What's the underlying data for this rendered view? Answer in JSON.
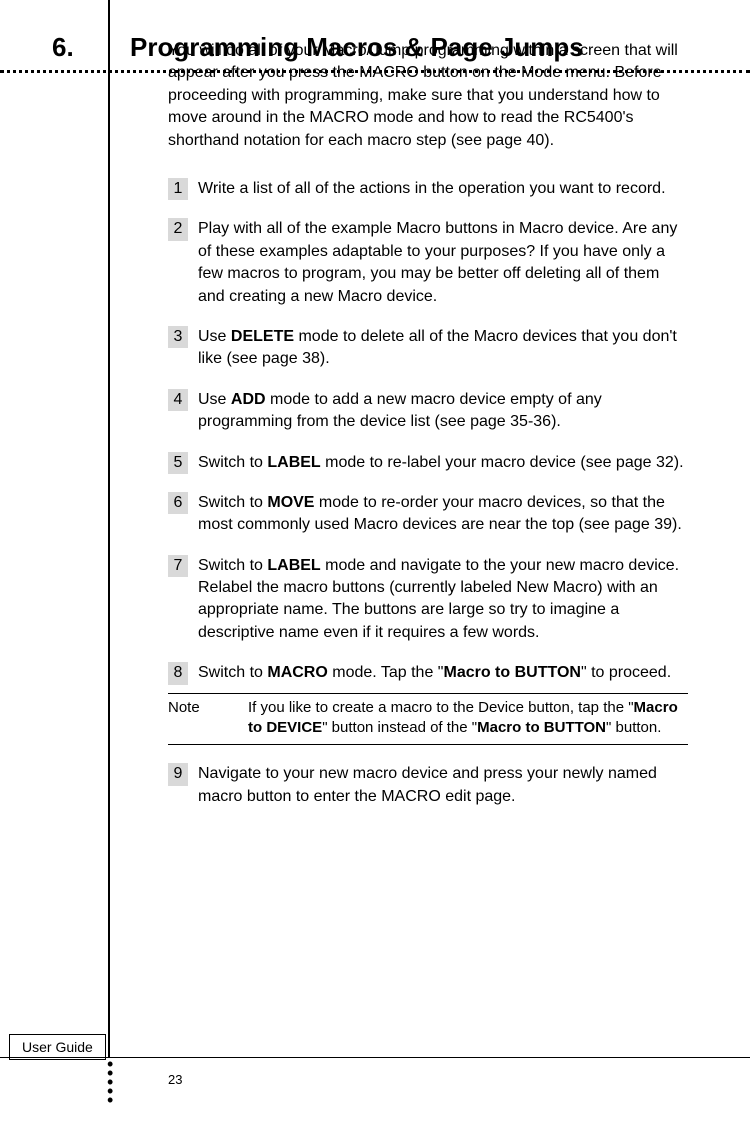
{
  "chapter": {
    "number": "6.",
    "title": "Programming Macros & Page Jumps"
  },
  "intro": "You will do all of your Macro/Jump programming within a screen that will appear after you press the MACRO button on the Mode menu. Before proceeding with programming, make sure that you understand how to move around in the MACRO mode and how to read the RC5400's shorthand notation for each macro step (see page 40).",
  "steps": {
    "s1": {
      "n": "1",
      "t": "Write a list of all of the actions in the operation you want to record."
    },
    "s2": {
      "n": "2",
      "t": "Play with all of the example Macro buttons in Macro device. Are any of these examples adaptable to your purposes?  If you have only a few macros to program, you may be better off deleting all of them and creating a new Macro device."
    },
    "s3": {
      "n": "3",
      "t_pre": "Use ",
      "t_b": "DELETE",
      "t_post": " mode to delete all of the Macro devices that you don't like (see page 38)."
    },
    "s4": {
      "n": "4",
      "t_pre": "Use ",
      "t_b": "ADD",
      "t_post": " mode to add a new macro device empty of any programming from the device list (see page 35-36)."
    },
    "s5": {
      "n": "5",
      "t_pre": "Switch to ",
      "t_b": "LABEL",
      "t_post": " mode to re-label your macro device (see page 32)."
    },
    "s6": {
      "n": "6",
      "t_pre": "Switch to ",
      "t_b": "MOVE",
      "t_post": " mode to re-order your macro devices, so that the most commonly used Macro devices are near the top (see page 39)."
    },
    "s7": {
      "n": "7",
      "t_pre": "Switch to ",
      "t_b": "LABEL",
      "t_post": " mode and navigate to the your new macro device. Relabel the macro buttons (currently labeled New Macro) with an appropriate name. The buttons are large so try to imagine a descriptive name even if it requires a few words."
    },
    "s8": {
      "n": "8",
      "t_pre": "Switch to ",
      "t_b1": "MACRO",
      "t_mid": " mode. Tap the \"",
      "t_b2": "Macro to BUTTON",
      "t_post": "\" to proceed."
    },
    "s9": {
      "n": "9",
      "t": "Navigate to your new macro device and press your newly named macro button to enter the MACRO edit page."
    }
  },
  "note": {
    "label": "Note",
    "pre": "If you like to create a macro to the Device button, tap the \"",
    "b1": "Macro to DEVICE",
    "mid": "\" button instead of the \"",
    "b2": "Macro to BUTTON",
    "post": "\" button."
  },
  "footer": {
    "user_guide": "User Guide",
    "page": "23"
  }
}
